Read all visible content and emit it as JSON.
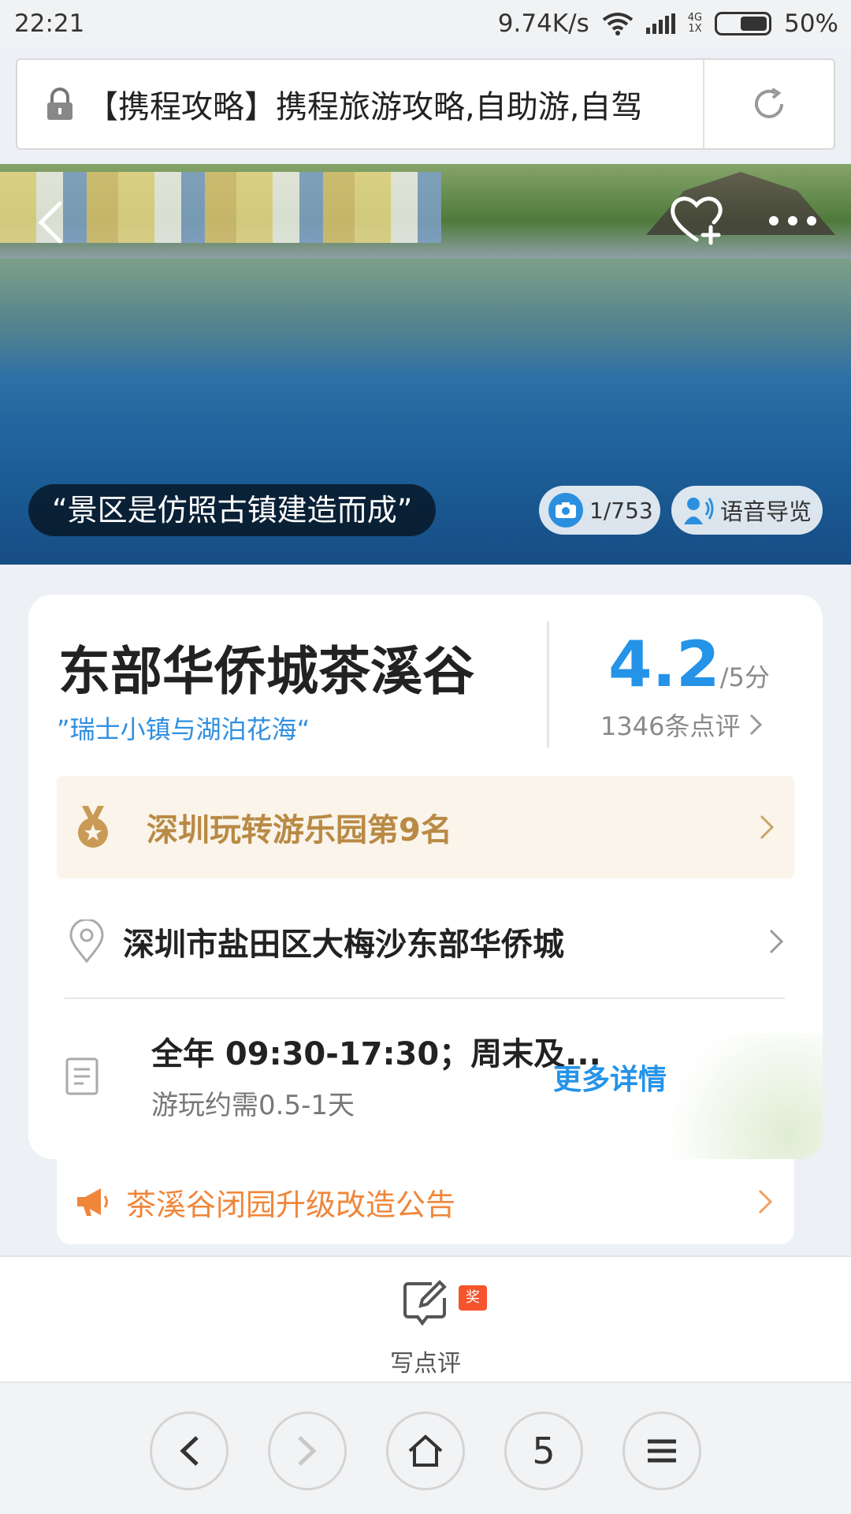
{
  "status_bar": {
    "time": "22:21",
    "net_speed": "9.74K/s",
    "net_type_top": "4G",
    "net_type_bottom": "1X",
    "battery": "50%",
    "battery_level": 0.5
  },
  "address_bar": {
    "url_text": "【携程攻略】携程旅游攻略,自助游,自驾",
    "lock_icon": "lock-icon",
    "reload_icon": "reload-icon"
  },
  "hero": {
    "quote": "“景区是仿照古镇建造而成”",
    "photo_counter": "1/753",
    "voice_guide": "语音导览"
  },
  "poi": {
    "name": "东部华侨城茶溪谷",
    "tagline": "”瑞士小镇与湖泊花海“",
    "score": "4.2",
    "score_suffix": "/5分",
    "review_count": "1346条点评",
    "rank": "深圳玩转游乐园第9名",
    "address": "深圳市盐田区大梅沙东部华侨城",
    "hours": "全年 09:30-17:30；周末及...",
    "duration": "游玩约需0.5-1天",
    "more_details": "更多详情"
  },
  "notice": {
    "text": "茶溪谷闭园升级改造公告"
  },
  "review_bar": {
    "label": "写点评",
    "badge": "奖"
  },
  "browser_nav": {
    "tab_count": "5"
  },
  "colors": {
    "accent_blue": "#2593e8",
    "rank_gold": "#b98a45",
    "notice_orange": "#f0863a",
    "badge_red": "#f5542c"
  }
}
